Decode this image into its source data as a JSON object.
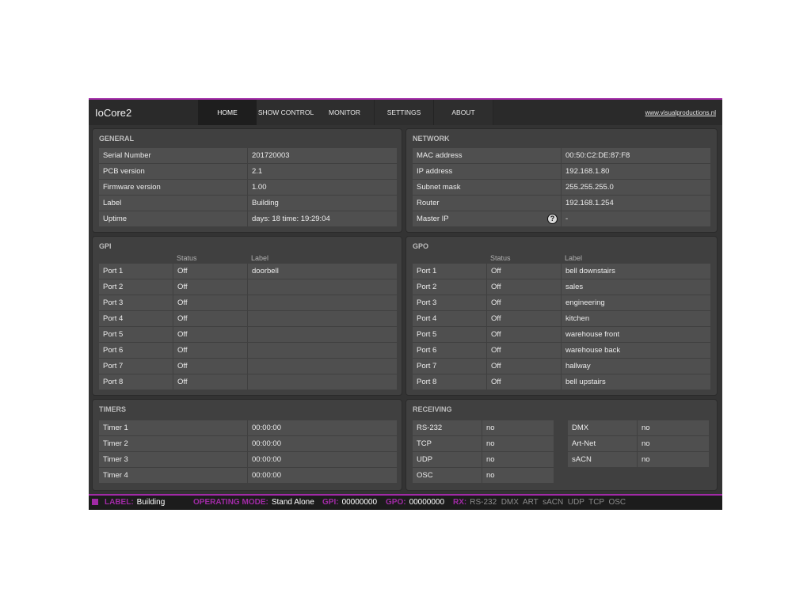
{
  "app": {
    "title": "IoCore2",
    "website": "www.visualproductions.nl",
    "tabs": [
      "HOME",
      "SHOW CONTROL",
      "MONITOR",
      "SETTINGS",
      "ABOUT"
    ],
    "active_tab": "HOME",
    "accent_color": "#a12aa6"
  },
  "general": {
    "title": "GENERAL",
    "rows": [
      {
        "label": "Serial Number",
        "value": "201720003"
      },
      {
        "label": "PCB version",
        "value": "2.1"
      },
      {
        "label": "Firmware version",
        "value": "1.00"
      },
      {
        "label": "Label",
        "value": "Building"
      },
      {
        "label": "Uptime",
        "value": "days: 18 time: 19:29:04"
      }
    ]
  },
  "network": {
    "title": "NETWORK",
    "rows": [
      {
        "label": "MAC address",
        "value": "00:50:C2:DE:87:F8"
      },
      {
        "label": "IP address",
        "value": "192.168.1.80"
      },
      {
        "label": "Subnet mask",
        "value": "255.255.255.0"
      },
      {
        "label": "Router",
        "value": "192.168.1.254"
      },
      {
        "label": "Master IP",
        "value": "-"
      }
    ],
    "help_icon": "question-circle-icon"
  },
  "gpi": {
    "title": "GPI",
    "status_header": "Status",
    "label_header": "Label",
    "rows": [
      {
        "port": "Port 1",
        "status": "Off",
        "label": "doorbell"
      },
      {
        "port": "Port 2",
        "status": "Off",
        "label": ""
      },
      {
        "port": "Port 3",
        "status": "Off",
        "label": ""
      },
      {
        "port": "Port 4",
        "status": "Off",
        "label": ""
      },
      {
        "port": "Port 5",
        "status": "Off",
        "label": ""
      },
      {
        "port": "Port 6",
        "status": "Off",
        "label": ""
      },
      {
        "port": "Port 7",
        "status": "Off",
        "label": ""
      },
      {
        "port": "Port 8",
        "status": "Off",
        "label": ""
      }
    ]
  },
  "gpo": {
    "title": "GPO",
    "status_header": "Status",
    "label_header": "Label",
    "rows": [
      {
        "port": "Port 1",
        "status": "Off",
        "label": "bell downstairs"
      },
      {
        "port": "Port 2",
        "status": "Off",
        "label": "sales"
      },
      {
        "port": "Port 3",
        "status": "Off",
        "label": "engineering"
      },
      {
        "port": "Port 4",
        "status": "Off",
        "label": "kitchen"
      },
      {
        "port": "Port 5",
        "status": "Off",
        "label": "warehouse front"
      },
      {
        "port": "Port 6",
        "status": "Off",
        "label": "warehouse back"
      },
      {
        "port": "Port 7",
        "status": "Off",
        "label": "hallway"
      },
      {
        "port": "Port 8",
        "status": "Off",
        "label": "bell upstairs"
      }
    ]
  },
  "timers": {
    "title": "TIMERS",
    "rows": [
      {
        "label": "Timer 1",
        "value": "00:00:00"
      },
      {
        "label": "Timer 2",
        "value": "00:00:00"
      },
      {
        "label": "Timer 3",
        "value": "00:00:00"
      },
      {
        "label": "Timer 4",
        "value": "00:00:00"
      }
    ]
  },
  "receiving": {
    "title": "RECEIVING",
    "left": [
      {
        "label": "RS-232",
        "value": "no"
      },
      {
        "label": "TCP",
        "value": "no"
      },
      {
        "label": "UDP",
        "value": "no"
      },
      {
        "label": "OSC",
        "value": "no"
      }
    ],
    "right": [
      {
        "label": "DMX",
        "value": "no"
      },
      {
        "label": "Art-Net",
        "value": "no"
      },
      {
        "label": "sACN",
        "value": "no"
      }
    ]
  },
  "statusbar": {
    "label_key": "LABEL:",
    "label_value": "Building",
    "mode_key": "OPERATING MODE:",
    "mode_value": "Stand Alone",
    "gpi_key": "GPI:",
    "gpi_value": "00000000",
    "gpo_key": "GPO:",
    "gpo_value": "00000000",
    "rx_key": "RX:",
    "rx_value": "RS-232  DMX  ART  sACN  UDP  TCP  OSC"
  }
}
